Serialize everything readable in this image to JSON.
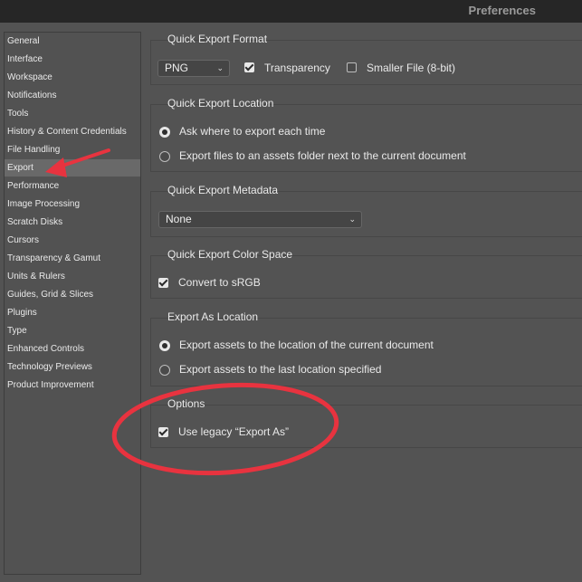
{
  "window": {
    "title": "Preferences"
  },
  "sidebar": {
    "items": [
      {
        "label": "General"
      },
      {
        "label": "Interface"
      },
      {
        "label": "Workspace"
      },
      {
        "label": "Notifications"
      },
      {
        "label": "Tools"
      },
      {
        "label": "History & Content Credentials"
      },
      {
        "label": "File Handling"
      },
      {
        "label": "Export",
        "selected": true
      },
      {
        "label": "Performance"
      },
      {
        "label": "Image Processing"
      },
      {
        "label": "Scratch Disks"
      },
      {
        "label": "Cursors"
      },
      {
        "label": "Transparency & Gamut"
      },
      {
        "label": "Units & Rulers"
      },
      {
        "label": "Guides, Grid & Slices"
      },
      {
        "label": "Plugins"
      },
      {
        "label": "Type"
      },
      {
        "label": "Enhanced Controls"
      },
      {
        "label": "Technology Previews"
      },
      {
        "label": "Product Improvement"
      }
    ]
  },
  "quick_export_format": {
    "title": "Quick Export Format",
    "format_value": "PNG",
    "transparency_label": "Transparency",
    "transparency_checked": true,
    "smaller_file_label": "Smaller File (8-bit)",
    "smaller_file_checked": false
  },
  "quick_export_location": {
    "title": "Quick Export Location",
    "option_ask": "Ask where to export each time",
    "option_assets_folder": "Export files to an assets folder next to the current document",
    "selected": "ask"
  },
  "quick_export_metadata": {
    "title": "Quick Export Metadata",
    "metadata_value": "None"
  },
  "quick_export_color_space": {
    "title": "Quick Export Color Space",
    "convert_label": "Convert to sRGB",
    "convert_checked": true
  },
  "export_as_location": {
    "title": "Export As Location",
    "option_current_doc": "Export assets to the location of the current document",
    "option_last_location": "Export assets to the last location specified",
    "selected": "current_doc"
  },
  "options": {
    "title": "Options",
    "legacy_label": "Use legacy “Export As”",
    "legacy_checked": true
  },
  "colors": {
    "annotation_red": "#e8333f",
    "background": "#535353",
    "titlebar": "#262626"
  }
}
